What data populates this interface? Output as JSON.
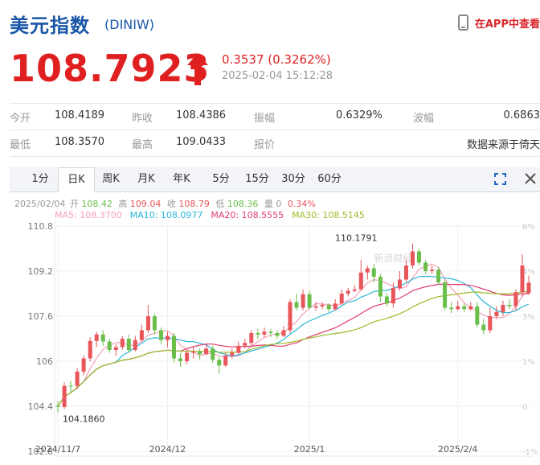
{
  "header": {
    "title": "美元指数",
    "code": "(DINIW)",
    "app_link": "在APP中查看"
  },
  "quote": {
    "price": "108.7923",
    "change": "0.3537",
    "change_pct": "(0.3262%)",
    "time": "2025-02-04 15:12:28",
    "direction": "up",
    "up_color": "#e02020"
  },
  "stats": {
    "rows": [
      [
        {
          "label": "今开",
          "value": "108.4189"
        },
        {
          "label": "昨收",
          "value": "108.4386"
        },
        {
          "label": "振幅",
          "value": "0.6329%"
        },
        {
          "label": "波幅",
          "value": "0.6863"
        }
      ],
      [
        {
          "label": "最低",
          "value": "108.3570"
        },
        {
          "label": "最高",
          "value": "109.0433"
        },
        {
          "label": "报价",
          "value": ""
        },
        {
          "label": "",
          "value": "数据来源于倚天"
        }
      ]
    ]
  },
  "tabs": [
    {
      "label": "1分"
    },
    {
      "label": "日K"
    },
    {
      "label": "周K"
    },
    {
      "label": "月K"
    },
    {
      "label": "年K"
    },
    {
      "label": "5分"
    },
    {
      "label": "15分"
    },
    {
      "label": "30分"
    },
    {
      "label": "60分"
    }
  ],
  "active_tab": 1,
  "ohlc_line": {
    "date": "2025/02/04",
    "items": [
      {
        "label": "开",
        "value": "108.42",
        "color": "#6abf4b"
      },
      {
        "label": "高",
        "value": "109.04",
        "color": "#e8555b"
      },
      {
        "label": "收",
        "value": "108.79",
        "color": "#e8555b"
      },
      {
        "label": "低",
        "value": "108.36",
        "color": "#6abf4b"
      },
      {
        "label": "量",
        "value": "0",
        "color": "#999999"
      },
      {
        "label": "",
        "value": "0.34%",
        "color": "#e8555b"
      }
    ]
  },
  "ma_legend": [
    {
      "label": "MA5: 108.3700",
      "color": "#f3a0b8"
    },
    {
      "label": "MA10: 108.0977",
      "color": "#2bb6d8"
    },
    {
      "label": "MA20: 108.5555",
      "color": "#e23b6f"
    },
    {
      "label": "MA30: 108.5145",
      "color": "#9bbd2a"
    }
  ],
  "chart_data": {
    "type": "candlestick",
    "y_ticks": [
      "110.8",
      "109.2",
      "107.6",
      "106",
      "104.4",
      "102.8"
    ],
    "y_range": [
      102.8,
      110.8
    ],
    "right_ticks": [
      "6%",
      "4%",
      "3%",
      "1%",
      "0",
      "-1%"
    ],
    "x_ticks": [
      {
        "index": 0,
        "label": "2024/11/7"
      },
      {
        "index": 17,
        "label": "2024/12"
      },
      {
        "index": 39,
        "label": "2025/1"
      },
      {
        "index": 62,
        "label": "2025/2/4"
      }
    ],
    "watermark": "新浪财经",
    "max_label": {
      "index": 47,
      "text": "110.1791",
      "value": 110.18
    },
    "min_label": {
      "index": 1,
      "text": "104.1860",
      "value": 104.19
    },
    "up_color": "#e8555b",
    "down_color": "#6abf4b",
    "candles": [
      [
        104.42,
        104.38,
        104.6,
        104.19
      ],
      [
        104.38,
        105.13,
        105.25,
        104.3
      ],
      [
        105.13,
        105.12,
        105.3,
        104.9
      ],
      [
        105.12,
        105.63,
        105.75,
        105.0
      ],
      [
        105.63,
        106.1,
        106.2,
        105.5
      ],
      [
        106.1,
        106.72,
        106.85,
        106.0
      ],
      [
        106.72,
        106.95,
        107.05,
        106.5
      ],
      [
        106.95,
        106.7,
        107.1,
        106.55
      ],
      [
        106.7,
        106.4,
        106.8,
        106.3
      ],
      [
        106.4,
        106.5,
        106.6,
        106.2
      ],
      [
        106.5,
        106.8,
        106.9,
        106.4
      ],
      [
        106.8,
        106.4,
        106.95,
        106.3
      ],
      [
        106.4,
        106.75,
        106.9,
        106.35
      ],
      [
        106.75,
        107.1,
        107.3,
        106.7
      ],
      [
        107.1,
        107.6,
        108.0,
        107.0
      ],
      [
        107.6,
        107.1,
        107.7,
        106.95
      ],
      [
        107.1,
        106.75,
        107.2,
        106.6
      ],
      [
        106.75,
        106.9,
        107.05,
        106.5
      ],
      [
        106.9,
        106.1,
        107.0,
        105.95
      ],
      [
        106.1,
        106.0,
        106.3,
        105.8
      ],
      [
        106.0,
        106.3,
        106.4,
        105.9
      ],
      [
        106.3,
        106.35,
        106.5,
        106.1
      ],
      [
        106.35,
        106.25,
        106.45,
        106.05
      ],
      [
        106.25,
        106.45,
        106.6,
        106.2
      ],
      [
        106.45,
        106.05,
        106.55,
        105.95
      ],
      [
        106.05,
        105.85,
        106.15,
        105.55
      ],
      [
        105.85,
        106.2,
        106.3,
        105.8
      ],
      [
        106.2,
        106.3,
        106.45,
        106.1
      ],
      [
        106.3,
        106.55,
        106.7,
        106.25
      ],
      [
        106.55,
        106.65,
        106.8,
        106.45
      ],
      [
        106.65,
        107.0,
        107.1,
        106.55
      ],
      [
        107.0,
        106.95,
        107.15,
        106.8
      ],
      [
        106.95,
        107.05,
        107.2,
        106.85
      ],
      [
        107.05,
        107.0,
        107.15,
        106.85
      ],
      [
        107.0,
        106.9,
        107.1,
        106.8
      ],
      [
        106.9,
        107.1,
        107.25,
        106.85
      ],
      [
        107.1,
        108.1,
        108.2,
        107.0
      ],
      [
        108.1,
        107.9,
        108.4,
        107.8
      ],
      [
        107.9,
        108.38,
        108.55,
        107.8
      ],
      [
        108.38,
        107.9,
        108.5,
        107.85
      ],
      [
        107.9,
        107.95,
        108.1,
        107.8
      ],
      [
        107.95,
        108.0,
        108.1,
        107.85
      ],
      [
        108.0,
        107.85,
        108.05,
        107.75
      ],
      [
        107.85,
        108.05,
        108.2,
        107.8
      ],
      [
        108.05,
        108.4,
        108.55,
        108.0
      ],
      [
        108.4,
        108.5,
        108.6,
        108.3
      ],
      [
        108.5,
        108.55,
        108.7,
        108.45
      ],
      [
        108.55,
        109.15,
        109.6,
        108.5
      ],
      [
        109.15,
        109.3,
        109.4,
        108.9
      ],
      [
        109.3,
        109.0,
        109.45,
        108.8
      ],
      [
        109.0,
        108.3,
        109.1,
        108.1
      ],
      [
        108.3,
        108.05,
        108.4,
        107.95
      ],
      [
        108.05,
        108.6,
        108.8,
        107.9
      ],
      [
        108.6,
        108.9,
        109.2,
        108.5
      ],
      [
        108.9,
        109.4,
        109.6,
        108.8
      ],
      [
        109.4,
        109.9,
        110.18,
        109.3
      ],
      [
        109.9,
        109.5,
        110.0,
        109.4
      ],
      [
        109.5,
        109.2,
        109.6,
        109.1
      ],
      [
        109.2,
        109.25,
        109.4,
        109.1
      ],
      [
        109.25,
        108.8,
        109.35,
        108.7
      ],
      [
        108.8,
        107.9,
        108.9,
        107.8
      ],
      [
        107.9,
        107.85,
        108.1,
        107.7
      ],
      [
        107.85,
        107.95,
        108.15,
        107.8
      ],
      [
        107.95,
        107.85,
        108.05,
        107.75
      ],
      [
        107.85,
        107.95,
        108.1,
        107.8
      ],
      [
        107.95,
        107.3,
        108.1,
        107.2
      ],
      [
        107.3,
        107.1,
        107.5,
        106.95
      ],
      [
        107.1,
        107.6,
        107.9,
        107.0
      ],
      [
        107.6,
        107.75,
        107.95,
        107.5
      ],
      [
        107.75,
        108.0,
        108.15,
        107.6
      ],
      [
        108.0,
        107.95,
        108.2,
        107.85
      ],
      [
        107.95,
        108.45,
        108.55,
        107.8
      ],
      [
        108.45,
        109.4,
        109.8,
        108.3
      ],
      [
        108.42,
        108.79,
        109.04,
        108.36
      ]
    ]
  }
}
